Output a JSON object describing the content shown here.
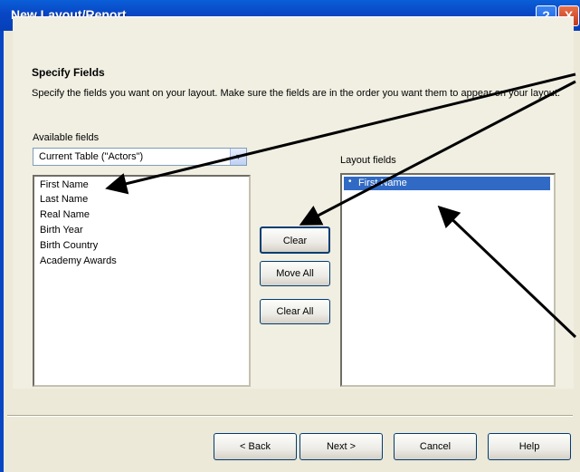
{
  "window": {
    "title": "New Layout/Report",
    "help_icon": "?",
    "close_icon": "X"
  },
  "section": {
    "heading": "Specify Fields",
    "description": "Specify the fields you want on your layout. Make sure the fields are in the order you want them to appear on your layout."
  },
  "available": {
    "label": "Available fields",
    "table_select": "Current Table (\"Actors\")",
    "items": [
      "First Name",
      "Last Name",
      "Real Name",
      "Birth Year",
      "Birth Country",
      "Academy Awards"
    ]
  },
  "layout": {
    "label": "Layout fields",
    "items": [
      "First Name"
    ]
  },
  "buttons": {
    "clear": "Clear",
    "move_all": "Move All",
    "clear_all": "Clear All"
  },
  "footer": {
    "back": "< Back",
    "next": "Next >",
    "cancel": "Cancel",
    "help": "Help"
  }
}
